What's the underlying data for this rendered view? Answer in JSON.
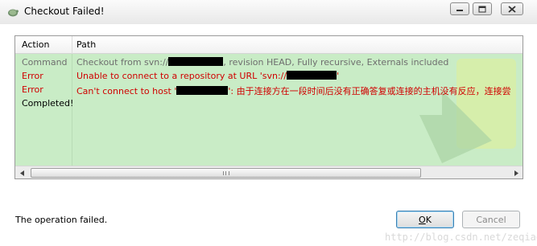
{
  "window": {
    "title": "Checkout Failed!"
  },
  "list": {
    "columns": {
      "action": "Action",
      "path": "Path"
    },
    "rows": [
      {
        "action": "Command",
        "path_before": "Checkout from svn://",
        "path_after": ", revision HEAD, Fully recursive, Externals included",
        "kind": "command"
      },
      {
        "action": "Error",
        "path_before": "Unable to connect to a repository at URL 'svn://",
        "path_after": "'",
        "kind": "error"
      },
      {
        "action": "Error",
        "path_before": "Can't connect to host '",
        "path_after": "': 由于连接方在一段时间后没有正确答复或连接的主机没有反应，连接尝",
        "kind": "error"
      },
      {
        "action": "Completed!",
        "path_before": "",
        "path_after": "",
        "kind": "done"
      }
    ]
  },
  "footer": {
    "status": "The operation failed.",
    "ok_label_underlined": "O",
    "ok_label_rest": "K",
    "cancel_label": "Cancel"
  },
  "watermark": "http://blog.csdn.net/zeqiao",
  "colors": {
    "list_background": "#c9ecc6",
    "error_text": "#d00000",
    "command_text": "#6e6e6e"
  },
  "icons": {
    "app": "tortoise-svn-icon",
    "minimize": "minimize-icon",
    "maximize": "maximize-icon",
    "close": "close-icon",
    "scroll_left": "arrow-left-icon",
    "scroll_right": "arrow-right-icon"
  }
}
